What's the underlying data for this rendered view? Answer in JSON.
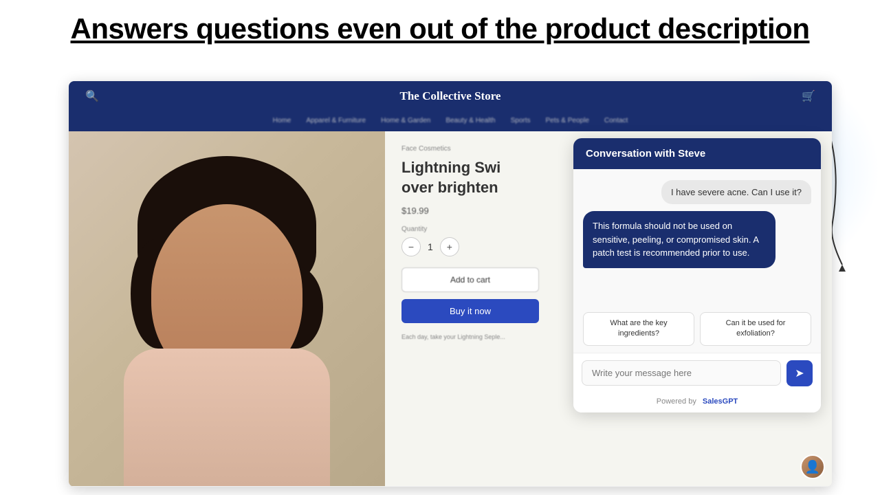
{
  "page": {
    "title": "Answers questions even out of the product description"
  },
  "store": {
    "name": "The Collective Store",
    "nav_links": [
      "Home",
      "Apparel & Furniture",
      "Home & Garden",
      "Beauty & Health",
      "Sports",
      "Pets & People",
      "Contact"
    ],
    "product": {
      "category": "Face Cosmetics",
      "name": "Lightning Swi...\nover brighten...",
      "name_line1": "Lightning Swi",
      "name_line2": "over brighten",
      "price": "$19.99",
      "quantity_label": "Quantity",
      "qty_value": "1",
      "add_to_cart": "Add to cart",
      "buy_now": "Buy it now",
      "description": "Each day, take your Lightning Seple..."
    }
  },
  "chat": {
    "header_title": "Conversation with Steve",
    "messages": [
      {
        "type": "user",
        "text": "I have severe acne. Can I use it?"
      },
      {
        "type": "bot",
        "text": "This formula should not be used on sensitive, peeling, or compromised skin. A patch test is recommended prior to use."
      }
    ],
    "suggestions": [
      {
        "id": "s1",
        "text": "What are the key ingredients?"
      },
      {
        "id": "s2",
        "text": "Can it be used for exfoliation?"
      }
    ],
    "input_placeholder": "Write your message here",
    "footer_text": "Powered by",
    "footer_brand": "SalesGPT",
    "send_icon": "➤"
  },
  "qty": {
    "minus": "−",
    "plus": "+"
  }
}
